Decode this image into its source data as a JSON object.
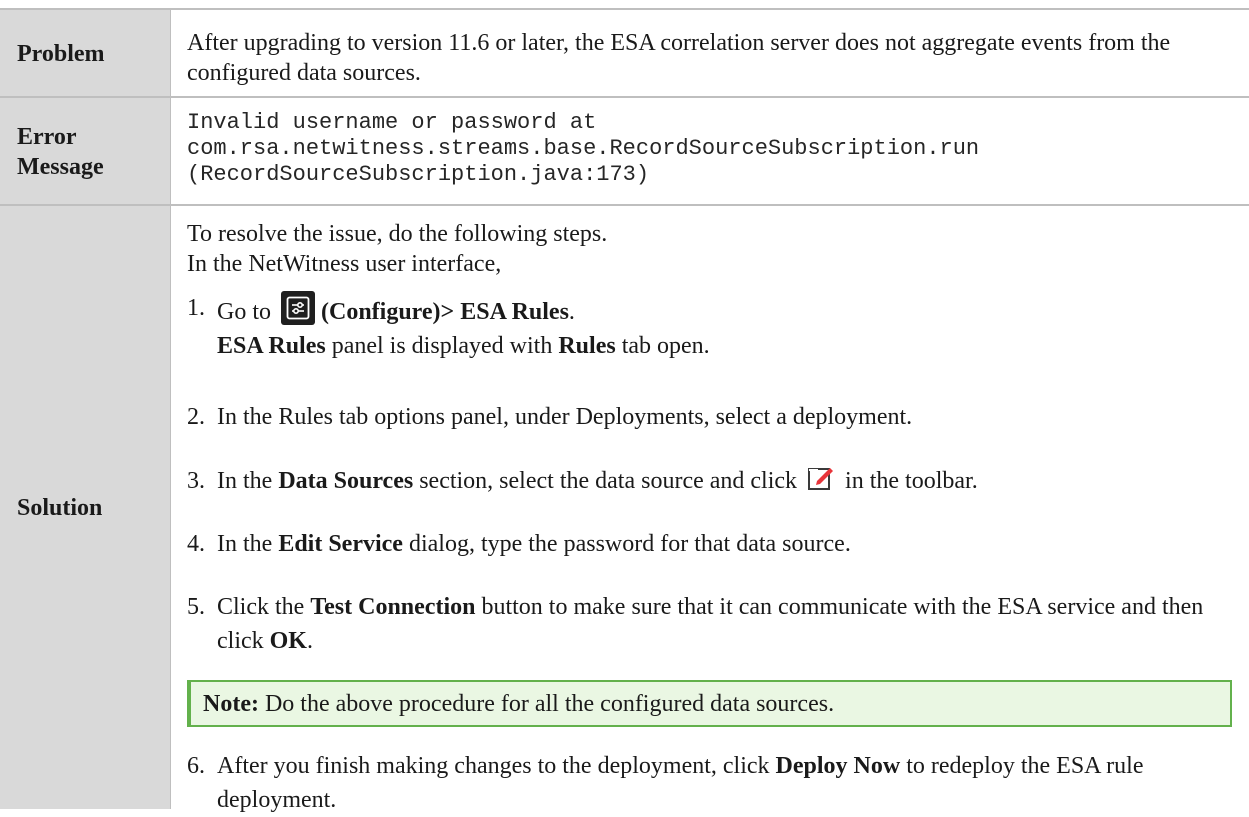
{
  "problem": {
    "label": "Problem",
    "text": "After upgrading to version 11.6 or later, the ESA correlation server does not aggregate events from the configured data sources."
  },
  "error": {
    "label_line1": "Error",
    "label_line2": "Message",
    "line1": "Invalid username or password at",
    "line2": "com.rsa.netwitness.streams.base.RecordSourceSubscription.run",
    "line3": "(RecordSourceSubscription.java:173)"
  },
  "solution": {
    "label": "Solution",
    "intro_line1": "To resolve the issue, do the following steps.",
    "intro_line2": "In the NetWitness user interface,",
    "steps": [
      {
        "num": "1.",
        "go_to": "Go to",
        "configure": "(Configure)> ESA Rules",
        "period": ".",
        "line2_bold1": "ESA Rules",
        "line2_mid": " panel is displayed with ",
        "line2_bold2": "Rules",
        "line2_end": " tab open."
      },
      {
        "num": "2.",
        "text": "In the Rules tab options panel, under Deployments, select a deployment."
      },
      {
        "num": "3.",
        "pre": "In the ",
        "bold": "Data Sources",
        "mid": " section, select the data source and click ",
        "post": " in the toolbar."
      },
      {
        "num": "4.",
        "pre": "In the ",
        "bold": "Edit Service",
        "post": " dialog, type the password for that data source."
      },
      {
        "num": "5.",
        "pre": "Click the ",
        "bold": "Test Connection",
        "mid": " button to make sure that it can communicate with the ESA service and then click ",
        "bold2": "OK",
        "post": "."
      },
      {
        "num": "6.",
        "pre": "After you finish making changes to the deployment, click ",
        "bold": "Deploy Now",
        "post": " to redeploy the ESA rule deployment."
      }
    ],
    "note_label": "Note:",
    "note_text": " Do the above procedure for all the configured data sources."
  },
  "icons": {
    "configure": "configure-icon",
    "edit": "edit-icon"
  },
  "colors": {
    "label_bg": "#d9d9d9",
    "note_bg": "#eaf7e3",
    "note_border": "#63b14c",
    "edit_icon_red": "#e8343a"
  }
}
